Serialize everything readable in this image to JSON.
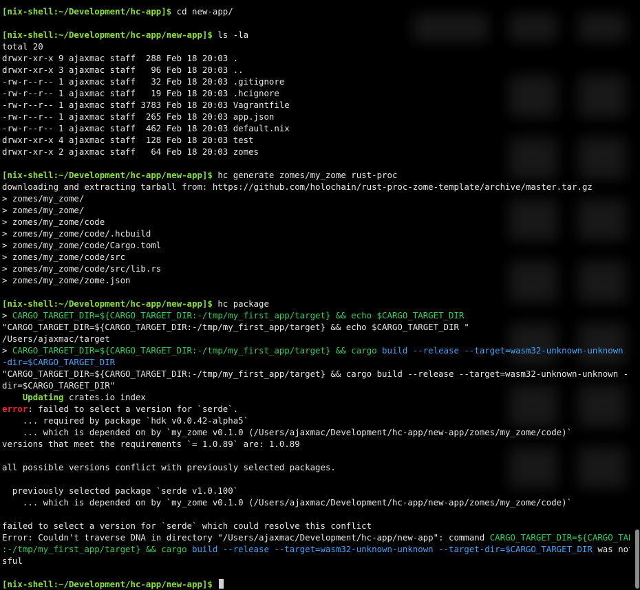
{
  "colors": {
    "background": "#000000",
    "prompt": "#8ae234",
    "text": "#e6e6e6",
    "green": "#2bd35b",
    "blue": "#3aa7ff",
    "error": "#ef2929"
  },
  "terminal": {
    "prompt1": "[nix-shell:~/Development/hc-app]$",
    "cmd1": " cd new-app/",
    "prompt2": "[nix-shell:~/Development/hc-app/new-app]$",
    "cmd2": " ls -la",
    "total": "total 20",
    "ls": [
      "drwxr-xr-x 9 ajaxmac staff  288 Feb 18 20:03 .",
      "drwxr-xr-x 3 ajaxmac staff   96 Feb 18 20:03 ..",
      "-rw-r--r-- 1 ajaxmac staff   32 Feb 18 20:03 .gitignore",
      "-rw-r--r-- 1 ajaxmac staff   19 Feb 18 20:03 .hcignore",
      "-rw-r--r-- 1 ajaxmac staff 3783 Feb 18 20:03 Vagrantfile",
      "-rw-r--r-- 1 ajaxmac staff  265 Feb 18 20:03 app.json",
      "-rw-r--r-- 1 ajaxmac staff  462 Feb 18 20:03 default.nix",
      "drwxr-xr-x 4 ajaxmac staff  128 Feb 18 20:03 test",
      "drwxr-xr-x 2 ajaxmac staff   64 Feb 18 20:03 zomes"
    ],
    "prompt3": "[nix-shell:~/Development/hc-app/new-app]$",
    "cmd3": " hc generate zomes/my_zome rust-proc",
    "download": "downloading and extracting tarball from: https://github.com/holochain/rust-proc-zome-template/archive/master.tar.gz",
    "files": [
      "> zomes/my_zome/",
      "> zomes/my_zome/",
      "> zomes/my_zome/code",
      "> zomes/my_zome/code/.hcbuild",
      "> zomes/my_zome/code/Cargo.toml",
      "> zomes/my_zome/code/src",
      "> zomes/my_zome/code/src/lib.rs",
      "> zomes/my_zome/zome.json"
    ],
    "prompt4": "[nix-shell:~/Development/hc-app/new-app]$",
    "cmd4": " hc package",
    "pkg_arrow1": "> ",
    "pkg_green1": "CARGO_TARGET_DIR=${CARGO_TARGET_DIR:-/tmp/my_first_app/target} && echo $CARGO_TARGET_DIR",
    "pkg_quote1": "\"CARGO_TARGET_DIR=${CARGO_TARGET_DIR:-/tmp/my_first_app/target} && echo $CARGO_TARGET_DIR \"",
    "pkg_users": "/Users/ajaxmac/target",
    "pkg_arrow2": "> ",
    "pkg_green2a": "CARGO_TARGET_DIR=${CARGO_TARGET_DIR:-/tmp/my_first_app/target} && cargo ",
    "pkg_blue2a": "build --release --target=wasm32-unknown-unknown --target",
    "pkg_blue2b": "-dir=$CARGO_TARGET_DIR",
    "pkg_quote2a": "\"CARGO_TARGET_DIR=${CARGO_TARGET_DIR:-/tmp/my_first_app/target} && cargo build --release --target=wasm32-unknown-unknown --target-",
    "pkg_quote2b": "dir=$CARGO_TARGET_DIR\"",
    "updating_indent": "    ",
    "updating": "Updating",
    "updating_rest": " crates.io index",
    "error_label": "error",
    "error_rest": ": failed to select a version for `serde`.",
    "req1": "    ... required by package `hdk v0.0.42-alpha5`",
    "req2": "    ... which is depended on by `my_zome v0.1.0 (/Users/ajaxmac/Development/hc-app/new-app/zomes/my_zome/code)`",
    "versions": "versions that meet the requirements `= 1.0.89` are: 1.0.89",
    "conflict": "all possible versions conflict with previously selected packages.",
    "prev1": "  previously selected package `serde v1.0.100`",
    "prev2": "    ... which is depended on by `my_zome v0.1.0 (/Users/ajaxmac/Development/hc-app/new-app/zomes/my_zome/code)`",
    "failed": "failed to select a version for `serde` which could resolve this conflict",
    "err_a": "Error: Couldn't traverse DNA in directory \"/Users/ajaxmac/Development/hc-app/new-app\": command ",
    "err_green_a": "CARGO_TARGET_DIR=${CARGO_TARGET_DIR",
    "err_green_b": ":-/tmp/my_first_app/target} && cargo ",
    "err_blue_b": "build --release --target=wasm32-unknown-unknown --target-dir=$CARGO_TARGET_DIR",
    "err_tail_b": " was not succes",
    "err_tail_c": "sful",
    "prompt5": "[nix-shell:~/Development/hc-app/new-app]$",
    "cmd5": " "
  }
}
